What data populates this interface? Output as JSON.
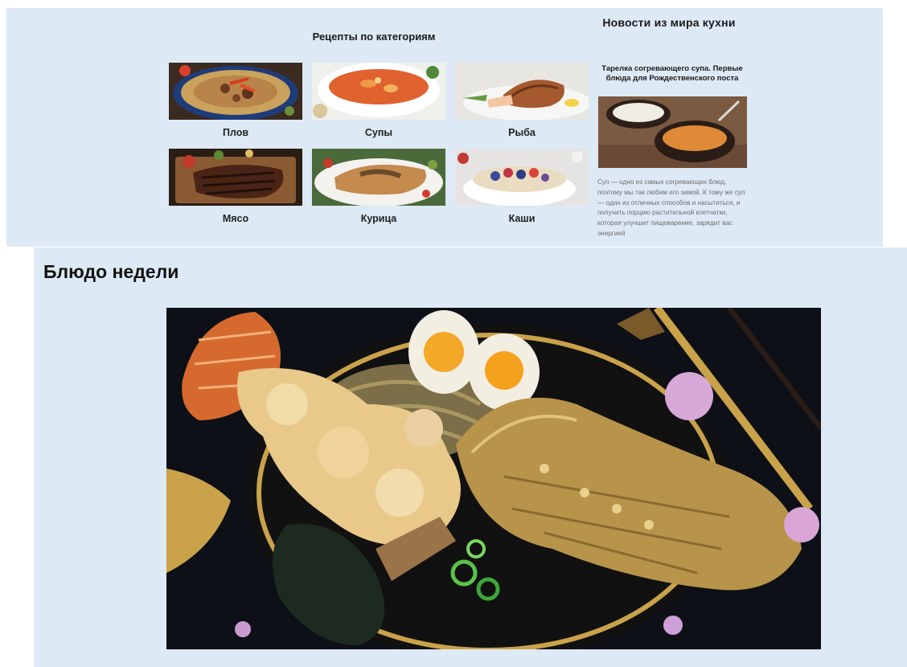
{
  "top": {
    "news_title": "Новости из мира кухни",
    "categories_title": "Рецепты по категориям",
    "categories": [
      {
        "label": "Плов"
      },
      {
        "label": "Супы"
      },
      {
        "label": "Рыба"
      },
      {
        "label": "Мясо"
      },
      {
        "label": "Курица"
      },
      {
        "label": "Каши"
      }
    ],
    "news": {
      "headline": "Тарелка согревающего супа. Первые блюда для Рождественского поста",
      "text": "Суп — одно из самых согревающих блюд, поэтому мы так любим его зимой. К тому же суп — один из отличных способов и насытиться, и получить порцию растительной клетчатки, которая улучшит пищеварение, зарядит вас энергией"
    }
  },
  "week": {
    "title": "Блюдо недели"
  },
  "colors": {
    "panel_bg": "#dde9f4",
    "photo_bg": "#0d1016",
    "gold": "#c9a24a"
  }
}
